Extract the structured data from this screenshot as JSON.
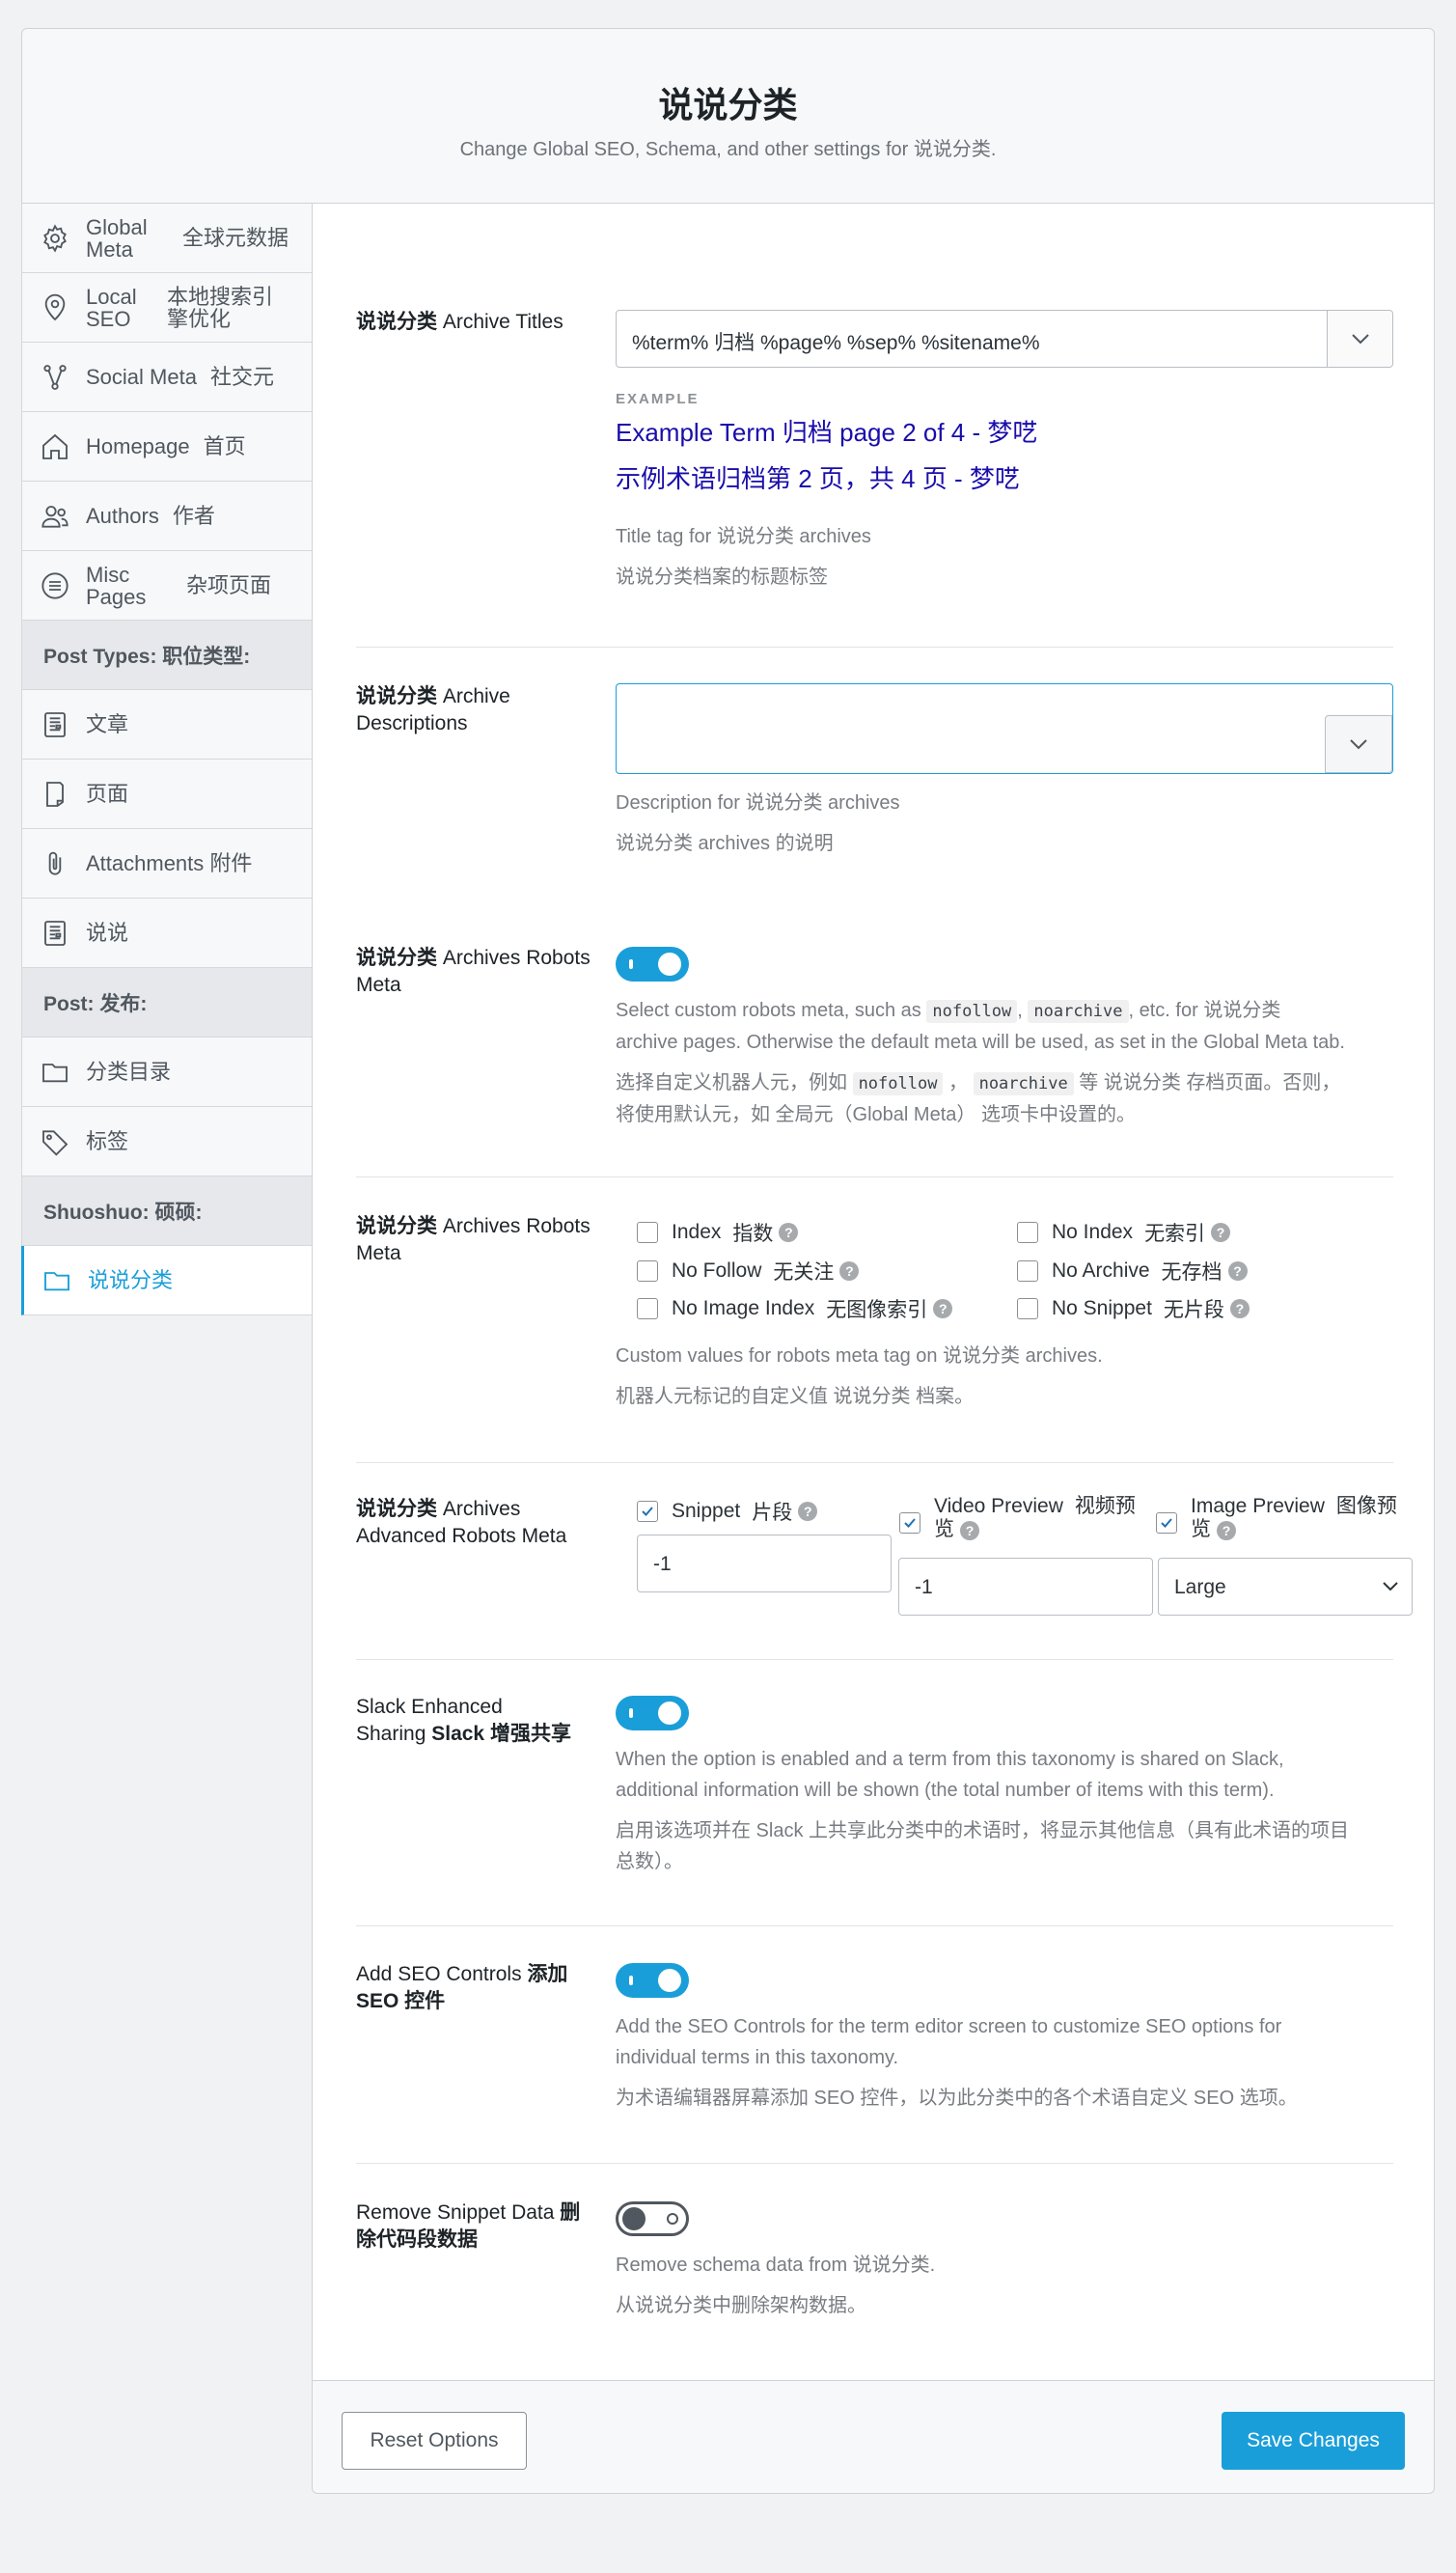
{
  "header": {
    "title": "说说分类",
    "subtitle": "Change Global SEO, Schema, and other settings for 说说分类."
  },
  "sidebar": {
    "items": [
      {
        "label": "Global Meta",
        "zh": "全球元数据",
        "icon": "gear-icon"
      },
      {
        "label": "Local SEO",
        "zh": "本地搜索引擎优化",
        "icon": "map-pin-icon"
      },
      {
        "label": "Social Meta",
        "zh": "社交元",
        "icon": "share-icon"
      },
      {
        "label": "Homepage",
        "zh": "首页",
        "icon": "home-icon"
      },
      {
        "label": "Authors",
        "zh": "作者",
        "icon": "users-icon"
      },
      {
        "label": "Misc Pages",
        "zh": "杂项页面",
        "icon": "list-icon"
      }
    ],
    "post_types_heading": "Post Types: 职位类型:",
    "post_types": [
      {
        "label": "文章",
        "icon": "document-icon"
      },
      {
        "label": "页面",
        "icon": "page-icon"
      },
      {
        "label": "Attachments 附件",
        "icon": "paperclip-icon"
      },
      {
        "label": "说说",
        "icon": "document-icon"
      }
    ],
    "post_heading": "Post: 发布:",
    "post_tax": [
      {
        "label": "分类目录",
        "icon": "folder-icon"
      },
      {
        "label": "标签",
        "icon": "tag-icon"
      }
    ],
    "shuoshuo_heading": "Shuoshuo: 硕硕:",
    "shuoshuo_tax": [
      {
        "label": "说说分类",
        "icon": "folder-icon",
        "active": true
      }
    ]
  },
  "titles": {
    "label_bold": "说说分类",
    "label_rest": " Archive Titles",
    "value": "%term% 归档 %page% %sep% %sitename%",
    "example_label": "EXAMPLE",
    "example_en": "Example Term 归档 page 2 of 4 - 梦呓",
    "example_zh": "示例术语归档第 2 页，共 4 页 - 梦呓",
    "help_en": "Title tag for 说说分类 archives",
    "help_zh": "说说分类档案的标题标签"
  },
  "descriptions": {
    "label_bold": "说说分类",
    "label_rest": " Archive Descriptions",
    "value": "",
    "help_en": "Description for 说说分类 archives",
    "help_zh": "说说分类 archives 的说明"
  },
  "robots_toggle": {
    "label_bold": "说说分类",
    "label_rest": " Archives Robots Meta",
    "on": true,
    "help_en_1": "Select custom robots meta, such as",
    "code1": "nofollow",
    "code2": "noarchive",
    "help_en_2": ", etc. for 说说分类",
    "help_en_3": "archive pages. Otherwise the default meta will be used, as set in the Global Meta tab.",
    "help_zh_1": "选择自定义机器人元，例如",
    "help_zh_2": "等 说说分类 存档页面。否则，",
    "help_zh_3": "将使用默认元，如 全局元（Global Meta） 选项卡中设置的。"
  },
  "robots_checks": {
    "label_bold": "说说分类",
    "label_rest": " Archives Robots Meta",
    "options": [
      {
        "label": "Index",
        "zh": "指数",
        "checked": false
      },
      {
        "label": "No Index",
        "zh": "无索引",
        "checked": false
      },
      {
        "label": "No Follow",
        "zh": "无关注",
        "checked": false
      },
      {
        "label": "No Archive",
        "zh": "无存档",
        "checked": false
      },
      {
        "label": "No Image Index",
        "zh": "无图像索引",
        "checked": false
      },
      {
        "label": "No Snippet",
        "zh": "无片段",
        "checked": false
      }
    ],
    "help_en": "Custom values for robots meta tag on 说说分类 archives.",
    "help_zh": "机器人元标记的自定义值 说说分类 档案。"
  },
  "advanced": {
    "label_bold": "说说分类",
    "label_rest": " Archives Advanced Robots Meta",
    "snippet_label": "Snippet",
    "snippet_zh": "片段",
    "snippet_value": "-1",
    "video_label": "Video Preview",
    "video_zh_1": "视频预",
    "video_zh_2": "览",
    "video_value": "-1",
    "image_label": "Image Preview",
    "image_zh_1": "图像预",
    "image_zh_2": "览",
    "image_value": "Large"
  },
  "slack": {
    "label_1": "Slack Enhanced",
    "label_2": "Sharing",
    "label_zh": "Slack 增强共享",
    "on": true,
    "help_en_1": "When the option is enabled and a term from this taxonomy is shared on Slack,",
    "help_en_2": "additional information will be shown (the total number of items with this term).",
    "help_zh_1": "启用该选项并在 Slack 上共享此分类中的术语时，将显示其他信息（具有此术语的项目",
    "help_zh_2": "总数）。"
  },
  "seo_controls": {
    "label_1": "Add SEO Controls",
    "label_zh_1": "添加",
    "label_zh_2": "SEO 控件",
    "on": true,
    "help_en_1": "Add the SEO Controls for the term editor screen to customize SEO options for",
    "help_en_2": "individual terms in this taxonomy.",
    "help_zh": "为术语编辑器屏幕添加 SEO 控件，以为此分类中的各个术语自定义 SEO 选项。"
  },
  "remove_snippet": {
    "label_1": "Remove Snippet Data",
    "label_zh_1": "删",
    "label_zh_2": "除代码段数据",
    "on": false,
    "help_en": "Remove schema data from 说说分类.",
    "help_zh": "从说说分类中删除架构数据。"
  },
  "footer": {
    "reset_label": "Reset Options",
    "save_label": "Save Changes"
  },
  "colors": {
    "accent": "#1a9ed9",
    "example_link": "#1a0dab"
  }
}
